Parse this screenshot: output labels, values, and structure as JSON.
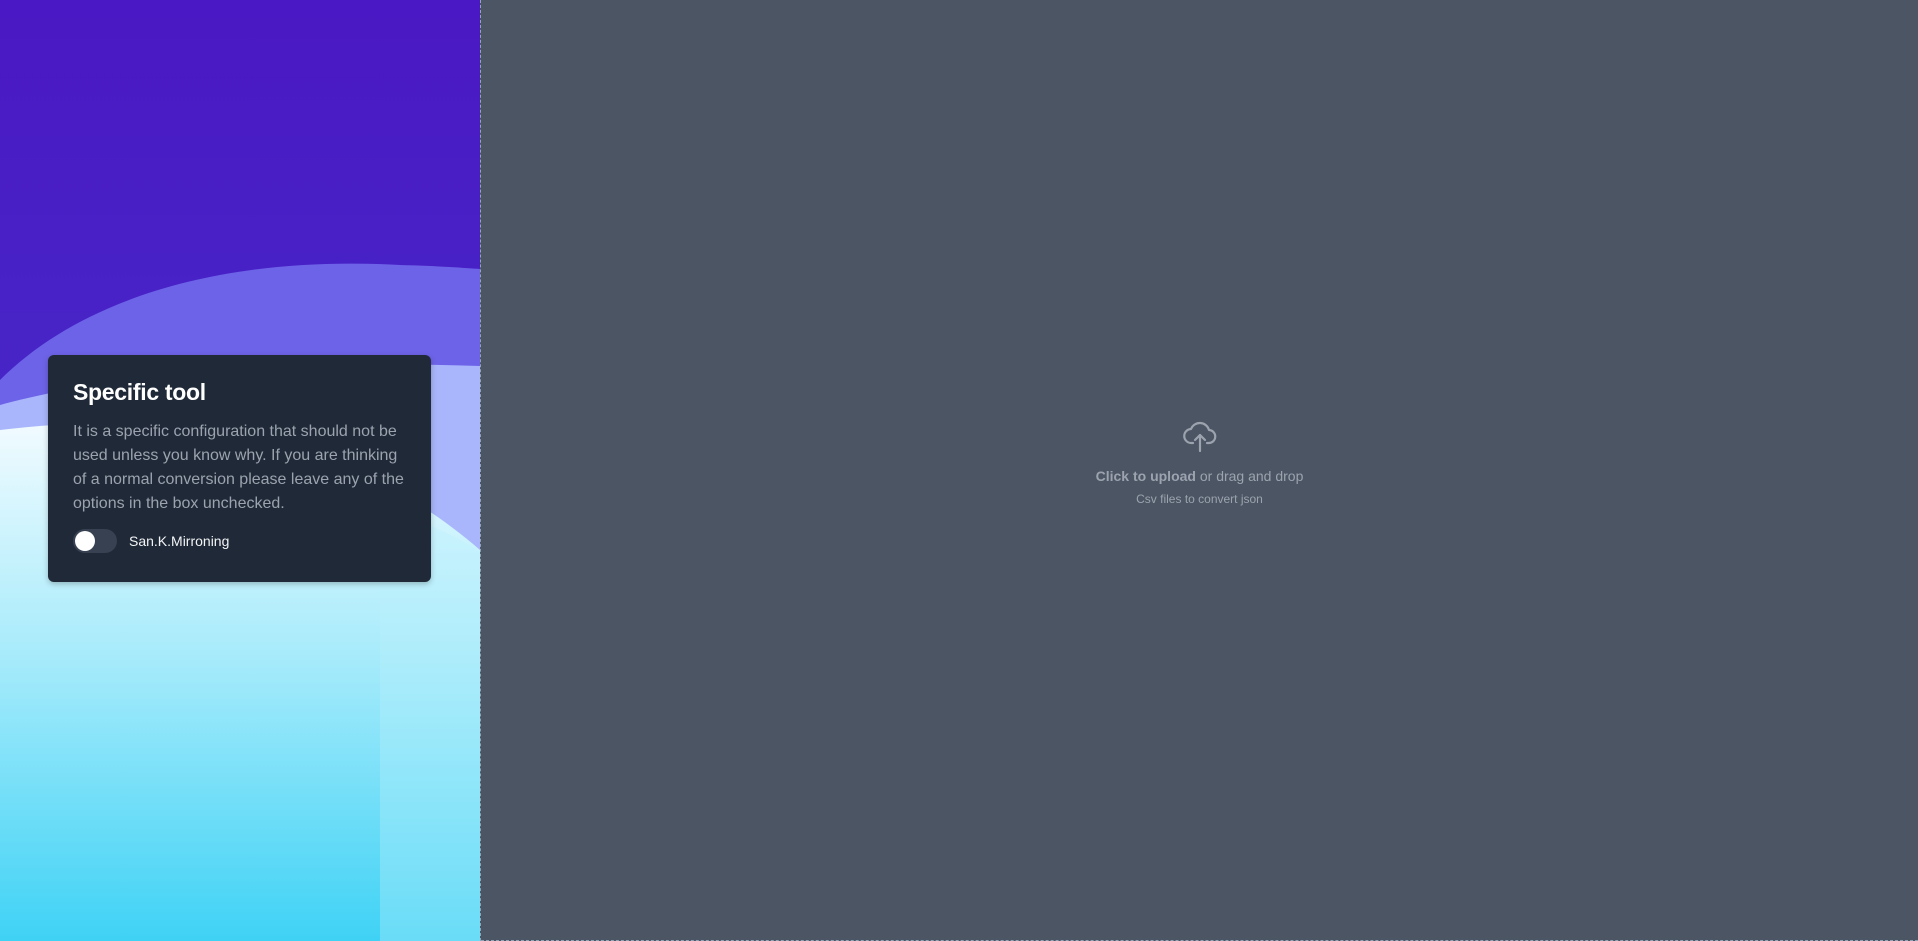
{
  "options_card": {
    "title": "Specific tool",
    "description": "It is a specific configuration that should not be used unless you know why. If you are thinking of a normal conversion please leave any of the options in the box unchecked.",
    "toggle": {
      "label": "San.K.Mirroning",
      "checked": false
    }
  },
  "upload": {
    "icon": "cloud-upload-icon",
    "click_text": "Click to upload",
    "rest_text": " or drag and drop",
    "hint": "Csv files to convert json"
  },
  "colors": {
    "card_bg": "#1f2937",
    "dropzone_bg": "#4b5563",
    "text_muted": "#9ca3af"
  }
}
